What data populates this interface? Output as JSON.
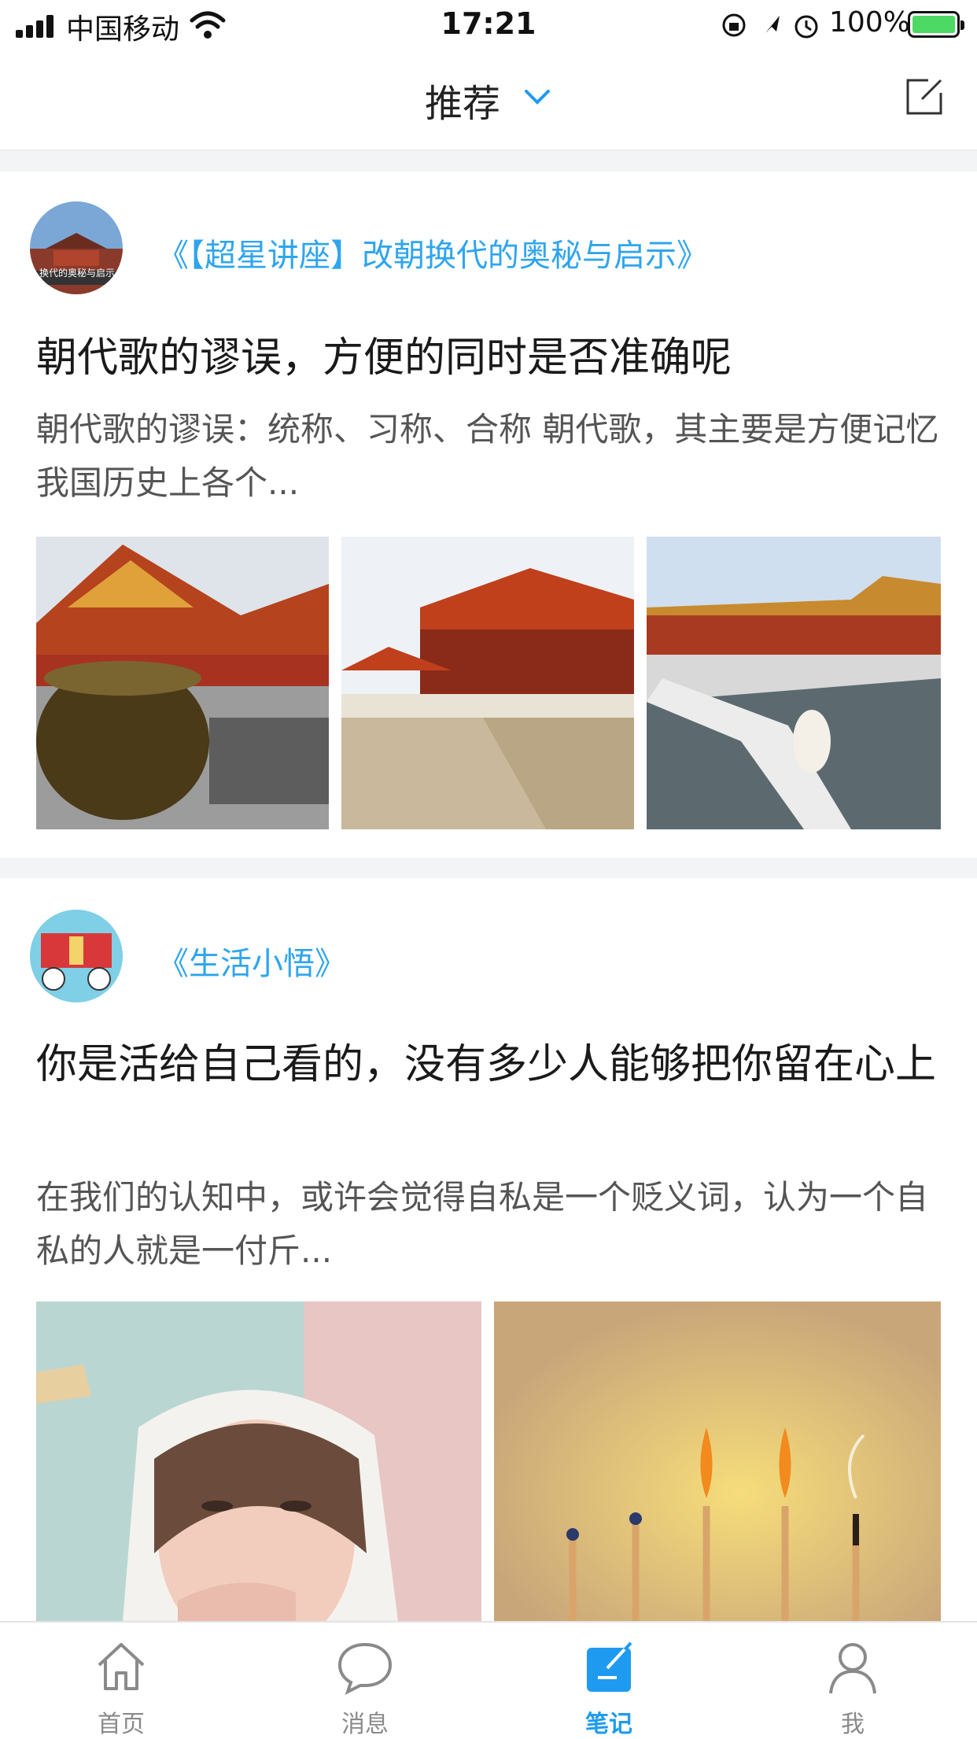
{
  "status_bar": {
    "carrier": "中国移动",
    "time": "17:21",
    "battery": "100%"
  },
  "header": {
    "title": "推荐"
  },
  "posts": [
    {
      "source": "《【超星讲座】改朝换代的奥秘与启示》",
      "avatar_caption": "换代的奥秘与启示",
      "title": "朝代歌的谬误，方便的同时是否准确呢",
      "excerpt": "朝代歌的谬误：统称、习称、合称 朝代歌，其主要是方便记忆我国历史上各个..."
    },
    {
      "source": "《生活小悟》",
      "title": "你是活给自己看的，没有多少人能够把你留在心上",
      "excerpt": "在我们的认知中，或许会觉得自私是一个贬义词，认为一个自私的人就是一付斤..."
    }
  ],
  "tabs": [
    {
      "label": "首页",
      "icon": "home-icon"
    },
    {
      "label": "消息",
      "icon": "chat-bubble-icon"
    },
    {
      "label": "笔记",
      "icon": "notes-icon",
      "active": true
    },
    {
      "label": "我",
      "icon": "person-icon"
    }
  ],
  "colors": {
    "accent": "#1e9bf0",
    "source_link": "#2fa5ee"
  }
}
